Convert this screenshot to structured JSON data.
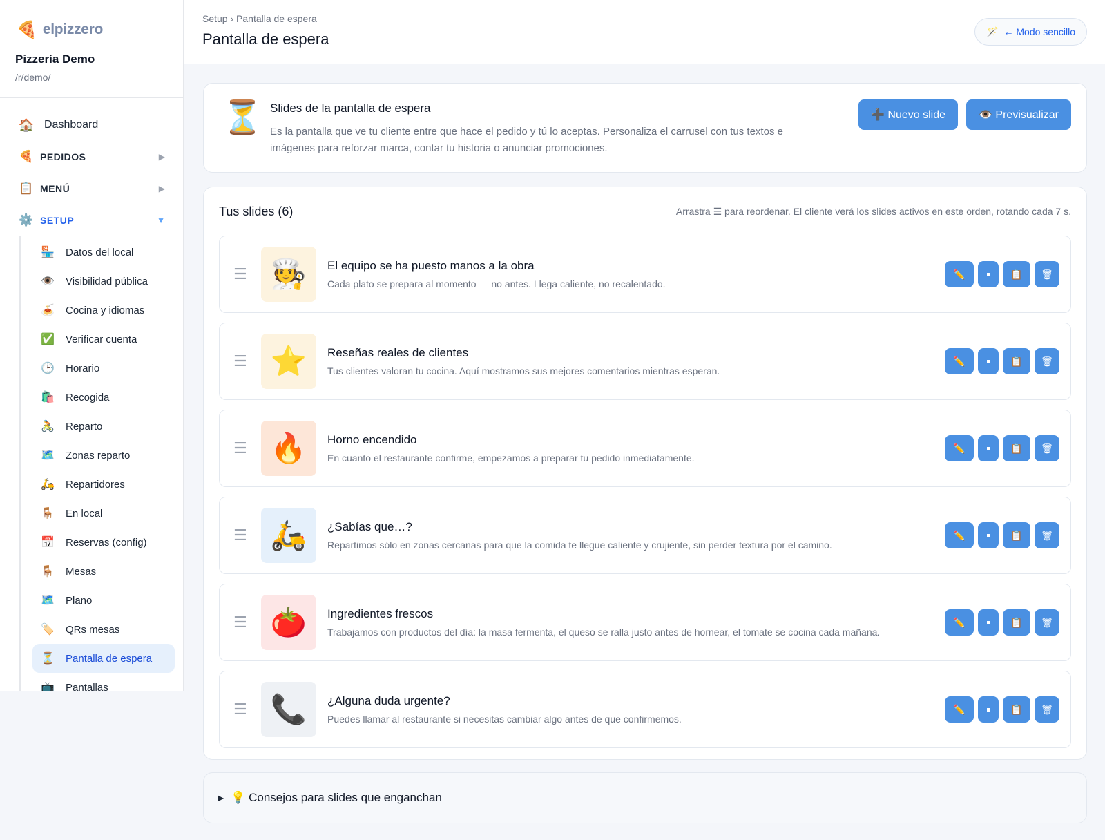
{
  "brand": {
    "name": "elpizzero",
    "icon": "🍕"
  },
  "restaurant": {
    "name": "Pizzería Demo",
    "path": "/r/demo/"
  },
  "nav": {
    "dashboard": {
      "icon": "🏠",
      "label": "Dashboard"
    },
    "pedidos": {
      "icon": "🍕",
      "label": "PEDIDOS",
      "arrow": "▶"
    },
    "menu": {
      "icon": "📋",
      "label": "MENÚ",
      "arrow": "▶"
    },
    "setup": {
      "icon": "⚙️",
      "label": "SETUP",
      "arrow": "▼"
    },
    "setup_items": [
      {
        "icon": "🏪",
        "label": "Datos del local"
      },
      {
        "icon": "👁️",
        "label": "Visibilidad pública"
      },
      {
        "icon": "🍝",
        "label": "Cocina y idiomas"
      },
      {
        "icon": "✅",
        "label": "Verificar cuenta"
      },
      {
        "icon": "🕒",
        "label": "Horario"
      },
      {
        "icon": "🛍️",
        "label": "Recogida"
      },
      {
        "icon": "🚴",
        "label": "Reparto"
      },
      {
        "icon": "🗺️",
        "label": "Zonas reparto"
      },
      {
        "icon": "🛵",
        "label": "Repartidores"
      },
      {
        "icon": "🪑",
        "label": "En local"
      },
      {
        "icon": "📅",
        "label": "Reservas (config)"
      },
      {
        "icon": "🪑",
        "label": "Mesas"
      },
      {
        "icon": "🗺️",
        "label": "Plano"
      },
      {
        "icon": "🏷️",
        "label": "QRs mesas"
      },
      {
        "icon": "⏳",
        "label": "Pantalla de espera"
      },
      {
        "icon": "📺",
        "label": "Pantallas"
      }
    ]
  },
  "header": {
    "breadcrumb": "Setup › Pantalla de espera",
    "title": "Pantalla de espera",
    "mode_icon": "🪄",
    "mode_label": "← Modo sencillo"
  },
  "intro": {
    "icon": "⏳",
    "title": "Slides de la pantalla de espera",
    "description": "Es la pantalla que ve tu cliente entre que hace el pedido y tú lo aceptas. Personaliza el carrusel con tus textos e imágenes para reforzar marca, contar tu historia o anunciar promociones.",
    "new_button": "➕ Nuevo slide",
    "preview_button": "👁️ Previsualizar"
  },
  "slides": {
    "title": "Tus slides (6)",
    "hint": "Arrastra ☰ para reordenar. El cliente verá los slides activos en este orden, rotando cada 7 s.",
    "drag_glyph": "☰",
    "actions": {
      "edit": "✏️",
      "duplicate": "📋",
      "delete": "🗑"
    },
    "items": [
      {
        "emoji": "🧑‍🍳",
        "bg": "#fdf3df",
        "title": "El equipo se ha puesto manos a la obra",
        "desc": "Cada plato se prepara al momento — no antes. Llega caliente, no recalentado."
      },
      {
        "emoji": "⭐",
        "bg": "#fdf3df",
        "title": "Reseñas reales de clientes",
        "desc": "Tus clientes valoran tu cocina. Aquí mostramos sus mejores comentarios mientras esperan."
      },
      {
        "emoji": "🔥",
        "bg": "#fde6d8",
        "title": "Horno encendido",
        "desc": "En cuanto el restaurante confirme, empezamos a preparar tu pedido inmediatamente."
      },
      {
        "emoji": "🛵",
        "bg": "#e5f0fb",
        "title": "¿Sabías que…?",
        "desc": "Repartimos sólo en zonas cercanas para que la comida te llegue caliente y crujiente, sin perder textura por el camino."
      },
      {
        "emoji": "🍅",
        "bg": "#fde6e6",
        "title": "Ingredientes frescos",
        "desc": "Trabajamos con productos del día: la masa fermenta, el queso se ralla justo antes de hornear, el tomate se cocina cada mañana."
      },
      {
        "emoji": "📞",
        "bg": "#eef1f5",
        "title": "¿Alguna duda urgente?",
        "desc": "Puedes llamar al restaurante si necesitas cambiar algo antes de que confirmemos."
      }
    ]
  },
  "tips": {
    "triangle": "▶",
    "label": "💡 Consejos para slides que enganchan"
  },
  "colors": {
    "primary": "#4a90e2",
    "active_bg": "#e6f0fc",
    "accent_text": "#2563eb"
  }
}
